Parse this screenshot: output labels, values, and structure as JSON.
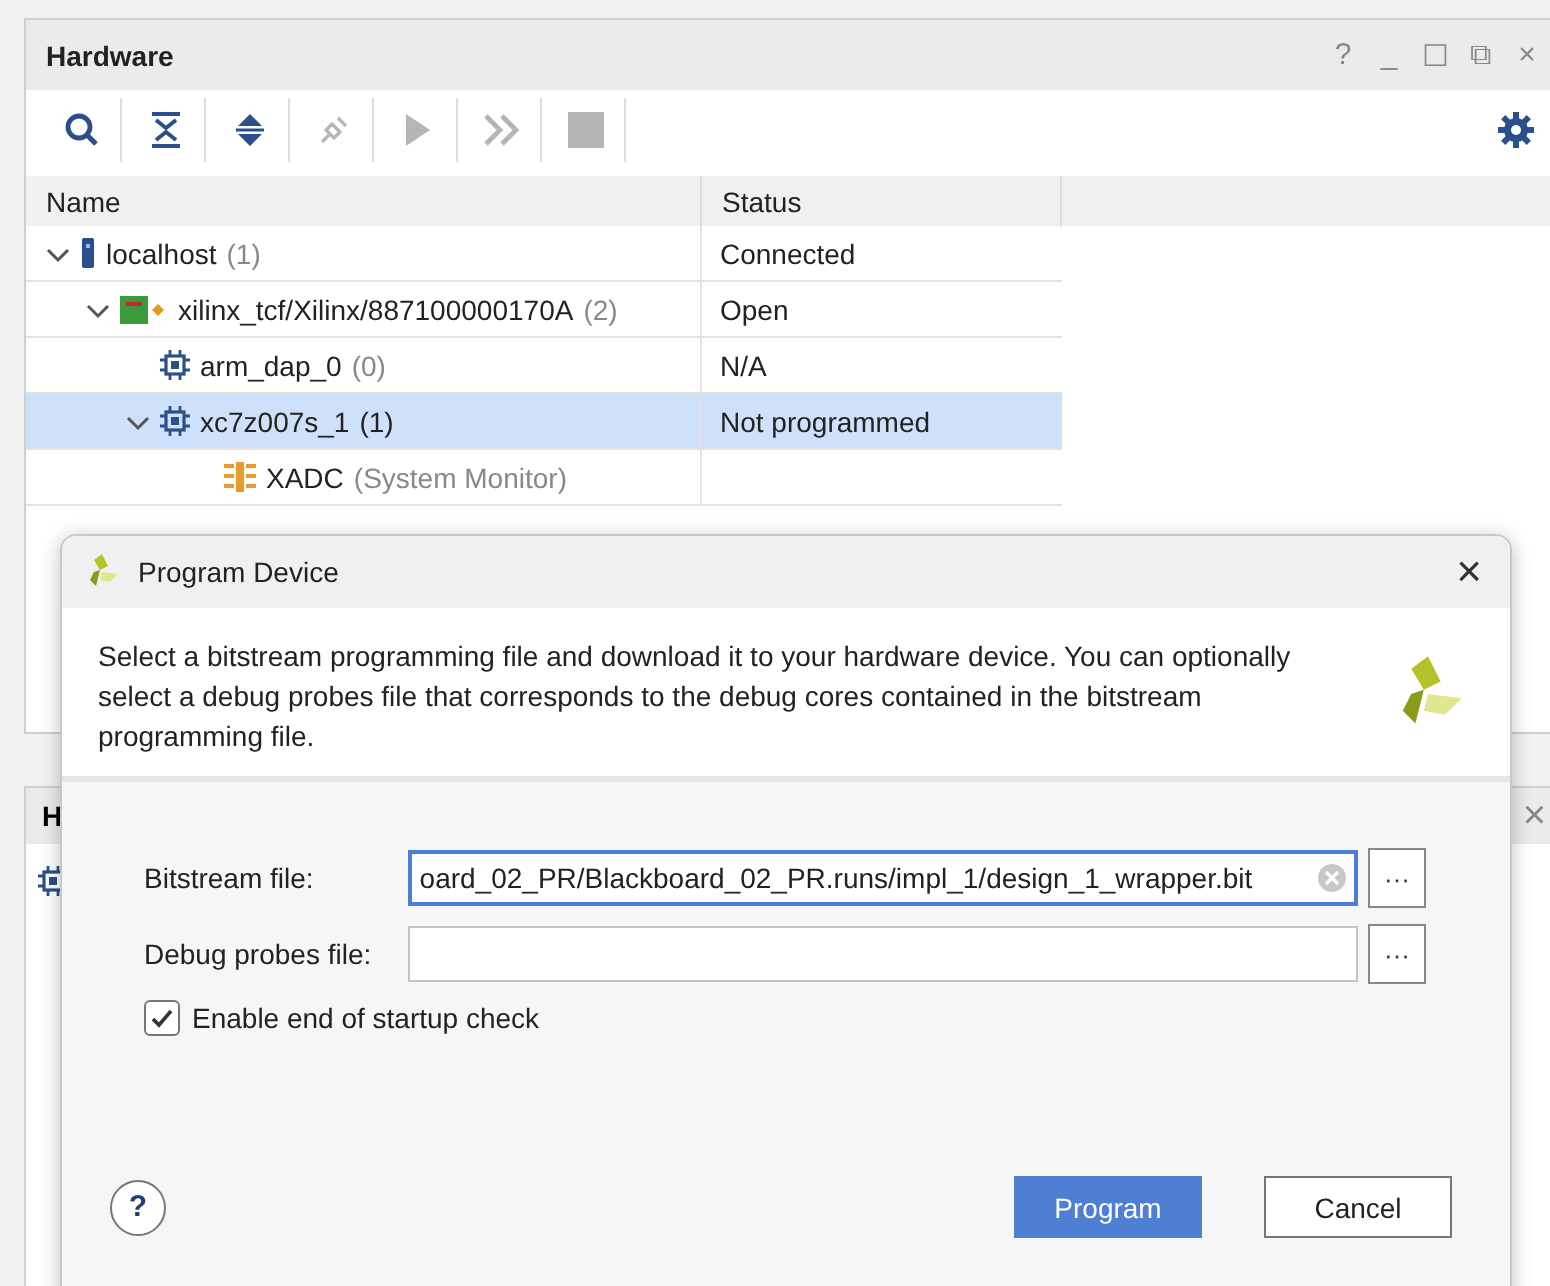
{
  "hardware_panel": {
    "title": "Hardware",
    "window_buttons": [
      "?",
      "_",
      "☐",
      "⧉",
      "×"
    ],
    "toolbar": [
      {
        "kind": "search",
        "disabled": false
      },
      {
        "kind": "collapse",
        "disabled": false
      },
      {
        "kind": "expand",
        "disabled": false
      },
      {
        "kind": "plug",
        "disabled": true
      },
      {
        "kind": "run",
        "disabled": true
      },
      {
        "kind": "skip",
        "disabled": true
      },
      {
        "kind": "stop",
        "disabled": true
      }
    ],
    "columns": [
      "Name",
      "Status"
    ],
    "tree": [
      {
        "kind": "server",
        "name": "localhost",
        "count": "(1)",
        "status": "Connected",
        "expanded": true,
        "selected": false,
        "children": [
          {
            "kind": "board",
            "name": "xilinx_tcf/Xilinx/887100000170A",
            "count": "(2)",
            "status": "Open",
            "expanded": true,
            "selected": false,
            "children": [
              {
                "kind": "chip",
                "name": "arm_dap_0",
                "count": "(0)",
                "status": "N/A",
                "selected": false
              },
              {
                "kind": "chip",
                "name": "xc7z007s_1",
                "count": "(1)",
                "status": "Not programmed",
                "expanded": true,
                "selected": true,
                "children": [
                  {
                    "kind": "monitor",
                    "name": "XADC",
                    "count": "(System Monitor)",
                    "selected": false
                  }
                ]
              }
            ]
          }
        ]
      }
    ]
  },
  "lower_panel": {
    "title": "H",
    "close": "×"
  },
  "dialog": {
    "title": "Program Device",
    "close": "×",
    "description": "Select a bitstream programming file and download it to your hardware device. You can optionally select a debug probes file that corresponds to the debug cores contained in the bitstream programming file.",
    "fields": [
      {
        "label": "Bitstream file:",
        "value": "oard_02_PR/Blackboard_02_PR.runs/impl_1/design_1_wrapper.bit",
        "focused": true,
        "browse": "···"
      },
      {
        "label": "Debug probes file:",
        "focused": false,
        "browse": "···"
      }
    ],
    "checkbox": {
      "label": "Enable end of startup check",
      "checked": true
    },
    "help": "?",
    "buttons": [
      {
        "label": "Program",
        "primary": true
      },
      {
        "label": "Cancel",
        "primary": false
      }
    ]
  }
}
